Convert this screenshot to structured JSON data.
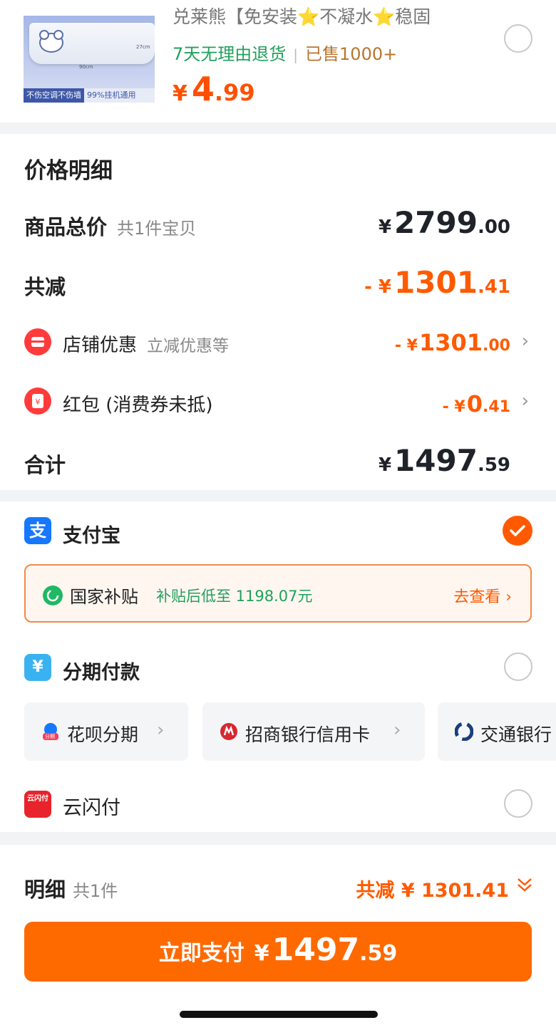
{
  "product": {
    "title": "兑莱熊【免安装⭐不凝水⭐稳固",
    "image_tag_left": "不伤空调不伤墙",
    "image_tag_right": "99%挂机通用",
    "image_dim_a": "90cm",
    "image_dim_b": "27cm",
    "return_policy": "7天无理由退货",
    "sold": "已售1000+",
    "price_symbol": "¥",
    "price_int": "4",
    "price_dec": ".99",
    "selected": false
  },
  "price_detail": {
    "title": "价格明细",
    "goods_total": {
      "label": "商品总价",
      "sub": "共1件宝贝",
      "symbol": "¥",
      "int": "2799",
      "dec": ".00"
    },
    "total_reduction": {
      "label": "共减",
      "symbol": "- ¥",
      "int": "1301",
      "dec": ".41"
    },
    "shop_discount": {
      "label": "店铺优惠",
      "sub": "立减优惠等",
      "symbol": "- ¥",
      "int": "1301",
      "dec": ".00",
      "icon": "shop-icon"
    },
    "red_packet": {
      "label": "红包 (消费券未抵)",
      "symbol": "- ¥",
      "int": "0",
      "dec": ".41",
      "icon": "red-packet-icon"
    },
    "total": {
      "label": "合计",
      "symbol": "¥",
      "int": "1497",
      "dec": ".59"
    },
    "colors": {
      "accent": "#ff5a00",
      "text": "#1f2329"
    }
  },
  "payment": {
    "alipay": {
      "label": "支付宝",
      "icon_char": "支",
      "icon_color": "#1677ff",
      "selected": true
    },
    "subsidy": {
      "label": "国家补贴",
      "sub": "补贴后低至 1198.07元",
      "link": "去查看 ›"
    },
    "installment": {
      "label": "分期付款",
      "icon_char": "¥",
      "icon_color": "#3bb2f0",
      "selected": false
    },
    "chips": [
      {
        "label": "花呗分期",
        "icon": "huabei-icon",
        "badge": "分期"
      },
      {
        "label": "招商银行信用卡",
        "icon": "cmb-icon"
      },
      {
        "label": "交通银行",
        "icon": "bocom-icon"
      }
    ],
    "unionpay": {
      "label": "云闪付",
      "icon_char": "云闪付",
      "icon_color": "#e8232b",
      "selected": false
    }
  },
  "bottom": {
    "label": "明细",
    "sub": "共1件",
    "discount": "共减 ¥ 1301.41",
    "pay_label": "立即支付",
    "pay_symbol": "¥",
    "pay_int": "1497",
    "pay_dec": ".59"
  }
}
